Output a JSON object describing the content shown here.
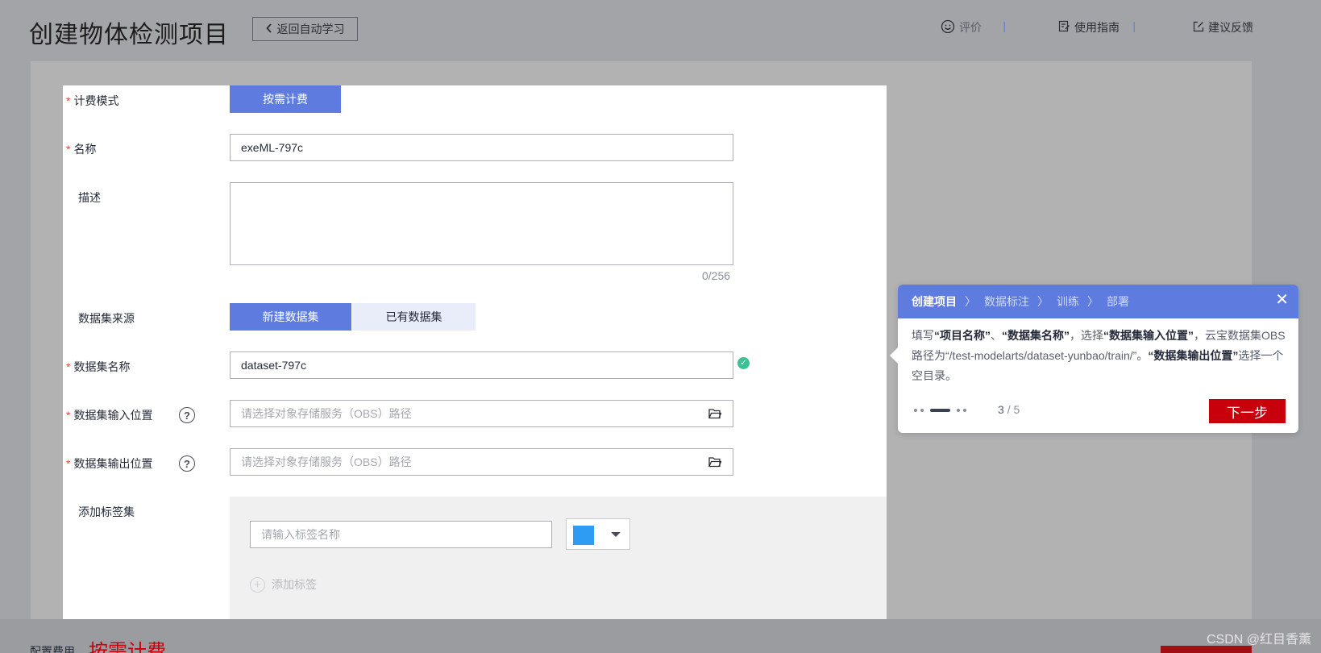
{
  "header": {
    "title": "创建物体检测项目",
    "back_label": "返回自动学习",
    "links": {
      "rate": "评价",
      "guide": "使用指南",
      "feedback": "建议反馈"
    }
  },
  "form": {
    "billing": {
      "label": "计费模式",
      "option": "按需计费"
    },
    "name": {
      "label": "名称",
      "value": "exeML-797c"
    },
    "description": {
      "label": "描述",
      "value": "",
      "counter": "0/256"
    },
    "dataset_source": {
      "label": "数据集来源",
      "options": [
        "新建数据集",
        "已有数据集"
      ]
    },
    "dataset_name": {
      "label": "数据集名称",
      "value": "dataset-797c"
    },
    "dataset_input": {
      "label": "数据集输入位置",
      "placeholder": "请选择对象存储服务（OBS）路径"
    },
    "dataset_output": {
      "label": "数据集输出位置",
      "placeholder": "请选择对象存储服务（OBS）路径"
    },
    "tag_set": {
      "label": "添加标签集",
      "tag_placeholder": "请输入标签名称",
      "color": "#2f9cf4",
      "add_label": "添加标签"
    }
  },
  "footer": {
    "fee_label": "配置费用",
    "fee_value": "按需计费",
    "watermark": "CSDN @红目香薰"
  },
  "guide": {
    "steps": [
      "创建项目",
      "数据标注",
      "训练",
      "部署"
    ],
    "active_step": 0,
    "body": {
      "t1": "填写",
      "b1": "“项目名称”",
      "t2": "、",
      "b2": "“数据集名称”",
      "t3": "，选择",
      "b3": "“数据集输入位置”",
      "t4": "，云宝数据集OBS路径为“/test-modelarts/dataset-yunbao/train/”。",
      "b4": "“数据集输出位置”",
      "t5": "选择一个空目录。"
    },
    "page_current": "3",
    "page_total": "/ 5",
    "next_label": "下一步"
  },
  "colors": {
    "primary": "#5e7ce0",
    "danger": "#c7000b",
    "success": "#3ac295"
  }
}
